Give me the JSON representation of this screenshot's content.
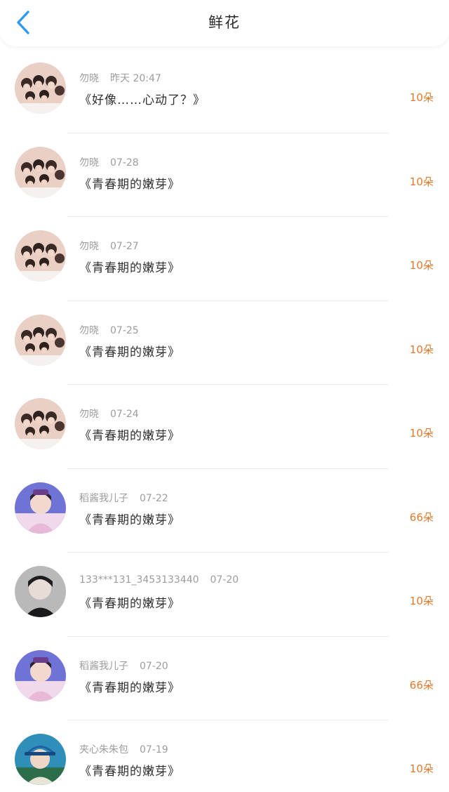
{
  "header": {
    "title": "鲜花",
    "back_icon": "chevron-left-icon",
    "accent_color": "#2d9bf0"
  },
  "colors": {
    "amount": "#e07a2e",
    "meta": "#9c9c9c",
    "gift_name": "#2e2e2e"
  },
  "items": [
    {
      "avatar": "group-photo",
      "name": "勿晓",
      "date": "昨天 20:47",
      "gift": "《好像……心动了？》",
      "amount": "10朵"
    },
    {
      "avatar": "group-photo",
      "name": "勿晓",
      "date": "07-28",
      "gift": "《青春期的嫩芽》",
      "amount": "10朵"
    },
    {
      "avatar": "group-photo",
      "name": "勿晓",
      "date": "07-27",
      "gift": "《青春期的嫩芽》",
      "amount": "10朵"
    },
    {
      "avatar": "group-photo",
      "name": "勿晓",
      "date": "07-25",
      "gift": "《青春期的嫩芽》",
      "amount": "10朵"
    },
    {
      "avatar": "group-photo",
      "name": "勿晓",
      "date": "07-24",
      "gift": "《青春期的嫩芽》",
      "amount": "10朵"
    },
    {
      "avatar": "boy-blue-photo",
      "name": "稻酱我儿子",
      "date": "07-22",
      "gift": "《青春期的嫩芽》",
      "amount": "66朵"
    },
    {
      "avatar": "boy-grey-photo",
      "name": "133***131_3453133440",
      "date": "07-20",
      "gift": "《青春期的嫩芽》",
      "amount": "10朵"
    },
    {
      "avatar": "boy-blue-photo",
      "name": "稻酱我儿子",
      "date": "07-20",
      "gift": "《青春期的嫩芽》",
      "amount": "66朵"
    },
    {
      "avatar": "boy-cap-photo",
      "name": "夹心朱朱包",
      "date": "07-19",
      "gift": "《青春期的嫩芽》",
      "amount": "10朵"
    }
  ]
}
